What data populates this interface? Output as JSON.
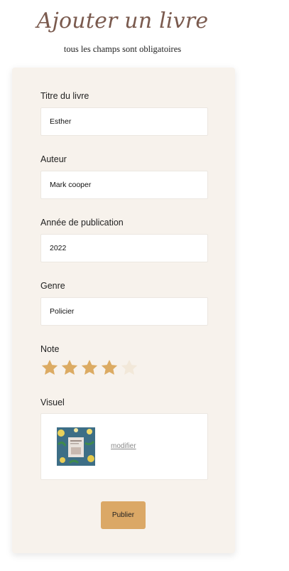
{
  "header": {
    "title": "Ajouter un livre",
    "subtitle": "tous les champs sont obligatoires"
  },
  "form": {
    "title_label": "Titre du livre",
    "title_value": "Esther",
    "author_label": "Auteur",
    "author_value": "Mark cooper",
    "year_label": "Année de publication",
    "year_value": "2022",
    "genre_label": "Genre",
    "genre_value": "Policier",
    "rating_label": "Note",
    "rating_value": 4,
    "rating_max": 5,
    "visual_label": "Visuel",
    "visual_modify": "modifier",
    "submit_label": "Publier"
  },
  "colors": {
    "accent": "#dba866",
    "star_on": "#dcab63",
    "star_off": "#f2e8d9",
    "title": "#7a5a4e",
    "card_bg": "#f7f2ec"
  }
}
